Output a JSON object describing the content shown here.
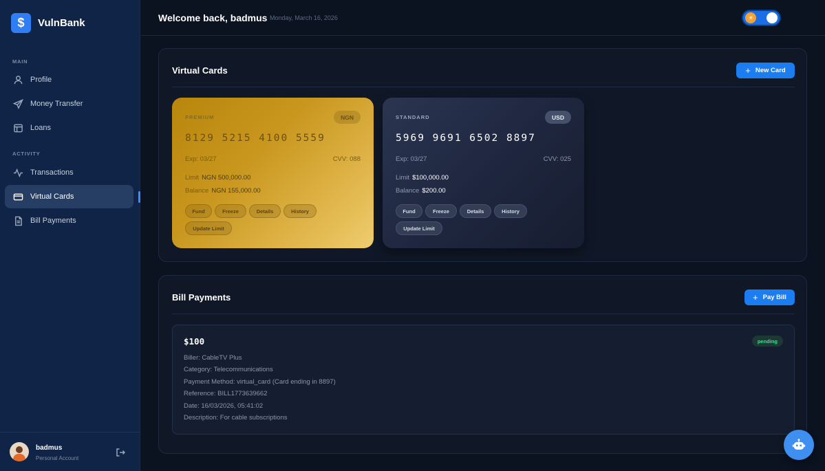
{
  "brand": {
    "logo": "$",
    "name": "VulnBank"
  },
  "sidebar": {
    "section_main": "MAIN",
    "section_activity": "ACTIVITY",
    "items": [
      {
        "label": "Profile",
        "icon": "user-icon"
      },
      {
        "label": "Money Transfer",
        "icon": "send-icon"
      },
      {
        "label": "Loans",
        "icon": "loans-icon"
      },
      {
        "label": "Transactions",
        "icon": "activity-icon"
      },
      {
        "label": "Virtual Cards",
        "icon": "card-icon",
        "active": true
      },
      {
        "label": "Bill Payments",
        "icon": "document-icon"
      }
    ],
    "user": {
      "name": "badmus",
      "role": "Personal Account"
    }
  },
  "header": {
    "welcome": "Welcome back, badmus",
    "date": "Monday, March 16, 2026",
    "theme_toggle": "on"
  },
  "virtual_cards": {
    "title": "Virtual Cards",
    "new_card_label": "New Card",
    "cards": [
      {
        "tier": "PREMIUM",
        "currency": "NGN",
        "number": "8129 5215 4100 5559",
        "expiry": "Exp: 03/27",
        "cvv": "CVV: 088",
        "limit_label": "Limit",
        "limit": "NGN 500,000.00",
        "balance_label": "Balance",
        "balance": "NGN 155,000.00",
        "actions": [
          "Fund",
          "Freeze",
          "Details",
          "History",
          "Update Limit"
        ],
        "style": "gold"
      },
      {
        "tier": "STANDARD",
        "currency": "USD",
        "number": "5969 9691 6502 8897",
        "expiry": "Exp: 03/27",
        "cvv": "CVV: 025",
        "limit_label": "Limit",
        "limit": "$100,000.00",
        "balance_label": "Balance",
        "balance": "$200.00",
        "actions": [
          "Fund",
          "Freeze",
          "Details",
          "History",
          "Update Limit"
        ],
        "style": "dark"
      }
    ]
  },
  "bill_payments": {
    "title": "Bill Payments",
    "pay_bill_label": "Pay Bill",
    "items": [
      {
        "amount": "$100",
        "status": "pending",
        "biller": "Biller: CableTV Plus",
        "category": "Category: Telecommunications",
        "method": "Payment Method: virtual_card (Card ending in 8897)",
        "reference": "Reference: BILL1773639662",
        "date": "Date: 16/03/2026, 05:41:02",
        "description": "Description: For cable subscriptions"
      }
    ]
  },
  "colors": {
    "accent": "#1c7df0",
    "sidebar_bg": "#0f2446",
    "page_bg": "#0b1220",
    "status_pending": "#3ddc97"
  }
}
